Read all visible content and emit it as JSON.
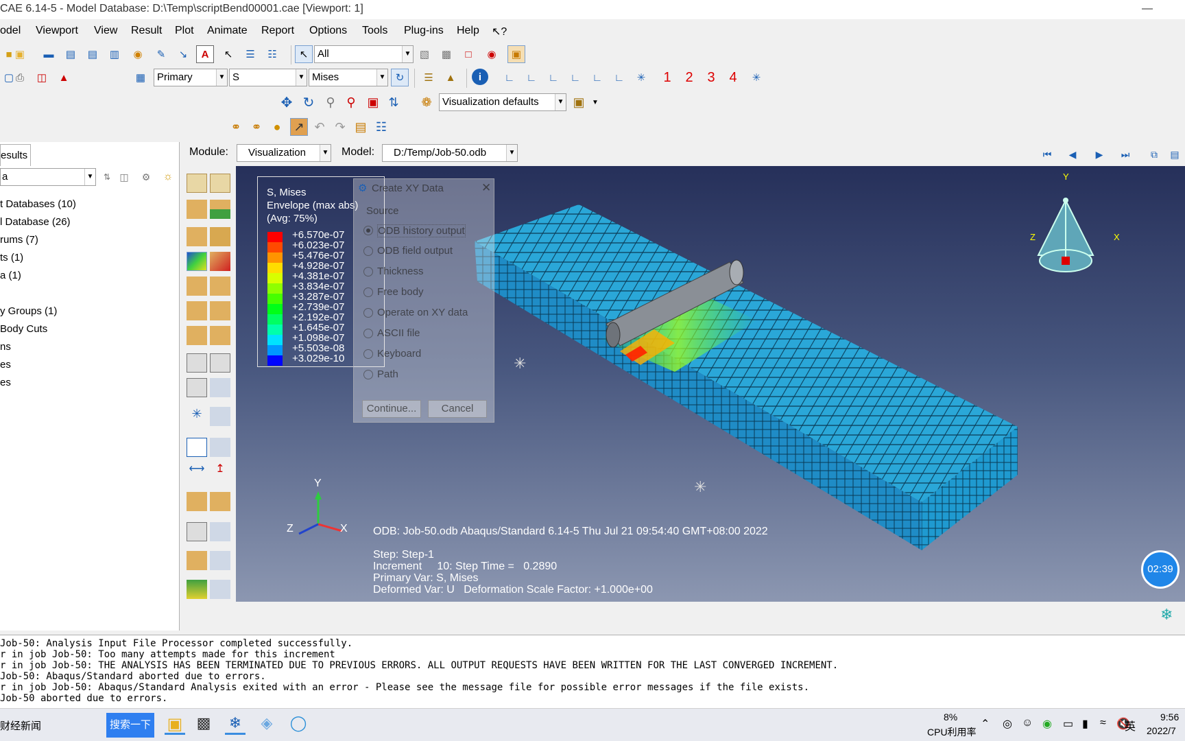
{
  "window": {
    "title": "CAE 6.14-5 - Model Database: D:\\Temp\\scriptBend00001.cae [Viewport: 1]",
    "minimize": "—"
  },
  "menu": [
    "odel",
    "Viewport",
    "View",
    "Result",
    "Plot",
    "Animate",
    "Report",
    "Options",
    "Tools",
    "Plug-ins",
    "Help",
    "↖?"
  ],
  "toolbar": {
    "selection_filter": "All",
    "field_primary": "Primary",
    "field_var": "S",
    "field_invariant": "Mises",
    "axis_labels": [
      "1",
      "2",
      "3",
      "4"
    ],
    "render_style": "Visualization defaults"
  },
  "context": {
    "module_label": "Module:",
    "module_value": "Visualization",
    "model_label": "Model:",
    "model_value": "D:/Temp/Job-50.odb"
  },
  "left_panel": {
    "tab": "esults",
    "filter_value": "a",
    "tree": [
      "t Databases (10)",
      "l Database (26)",
      "rums (7)",
      "ts (1)",
      "a (1)",
      "y Groups (1)",
      "Body Cuts",
      "ns",
      "es",
      "es"
    ]
  },
  "legend": {
    "title1": "S, Mises",
    "title2": "Envelope (max abs)",
    "title3": "(Avg: 75%)",
    "values": [
      "+6.570e-07",
      "+6.023e-07",
      "+5.476e-07",
      "+4.928e-07",
      "+4.381e-07",
      "+3.834e-07",
      "+3.287e-07",
      "+2.739e-07",
      "+2.192e-07",
      "+1.645e-07",
      "+1.098e-07",
      "+5.503e-08",
      "+3.029e-10"
    ],
    "colors": [
      "#ff0000",
      "#ff4a00",
      "#ff9400",
      "#ffdd00",
      "#d8ff00",
      "#8fff00",
      "#46ff00",
      "#00ff18",
      "#00ff62",
      "#00ffab",
      "#00e2ff",
      "#0098ff",
      "#0005ff"
    ]
  },
  "dialog": {
    "title": "Create XY Data",
    "group": "Source",
    "options": [
      "ODB history output",
      "ODB field output",
      "Thickness",
      "Free body",
      "Operate on XY data",
      "ASCII file",
      "Keyboard",
      "Path"
    ],
    "selected_index": 0,
    "continue": "Continue...",
    "cancel": "Cancel"
  },
  "viewport": {
    "odb_line": "ODB: Job-50.odb    Abaqus/Standard 6.14-5    Thu Jul 21 09:54:40 GMT+08:00 2022",
    "step": "Step: Step-1",
    "increment": "Increment     10: Step Time =   0.2890",
    "primary_var": "Primary Var: S, Mises",
    "deformed_var": "Deformed Var: U   Deformation Scale Factor: +1.000e+00",
    "triad": {
      "x": "X",
      "y": "Y",
      "z": "Z"
    },
    "timer": "02:39"
  },
  "messages": [
    "Job-50: Analysis Input File Processor completed successfully.",
    "r in job Job-50: Too many attempts made for this increment",
    "r in job Job-50: THE ANALYSIS HAS BEEN TERMINATED DUE TO PREVIOUS ERRORS. ALL OUTPUT REQUESTS HAVE BEEN WRITTEN FOR THE LAST CONVERGED INCREMENT.",
    "Job-50: Abaqus/Standard aborted due to errors.",
    "r in job Job-50: Abaqus/Standard Analysis exited with an error - Please see the  message file for possible error messages if the file exists.",
    "Job-50 aborted due to errors."
  ],
  "taskbar": {
    "news": "财经新闻",
    "search_button": "搜索一下",
    "cpu_percent": "8%",
    "cpu_label": "CPU利用率",
    "ime": "英",
    "time": "9:56",
    "date": "2022/7"
  }
}
